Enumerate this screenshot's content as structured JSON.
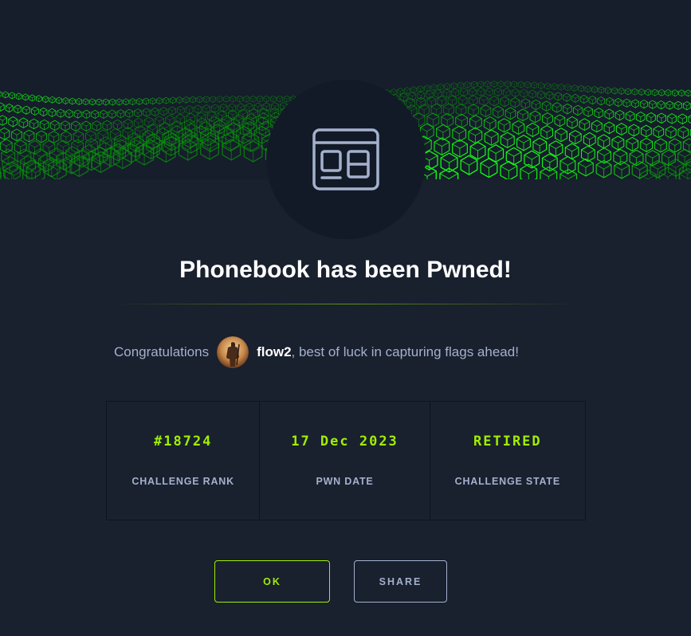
{
  "dialog": {
    "icon": "web-challenge-icon",
    "title": "Phonebook has been Pwned!",
    "congrats_prefix": "Congratulations",
    "username": "flow2",
    "congrats_suffix": ", best of luck in capturing flags ahead!"
  },
  "stats": [
    {
      "value": "#18724",
      "label": "CHALLENGE RANK"
    },
    {
      "value": "17 Dec 2023",
      "label": "PWN DATE"
    },
    {
      "value": "RETIRED",
      "label": "CHALLENGE STATE"
    }
  ],
  "buttons": {
    "ok": "OK",
    "share": "SHARE"
  },
  "colors": {
    "accent": "#9fef00",
    "background": "#19202e",
    "muted_text": "#a4b1cd"
  }
}
